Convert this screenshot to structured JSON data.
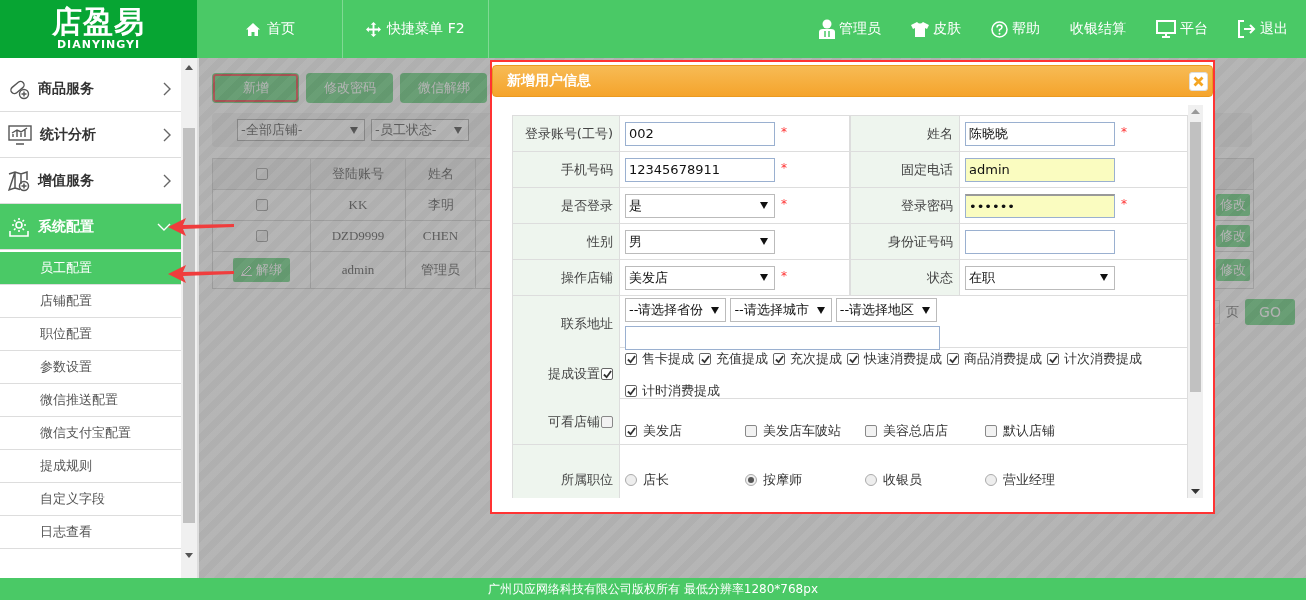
{
  "header": {
    "logo_title": "店盈易",
    "logo_subtitle": "DIANYINGYI",
    "nav": [
      "首页",
      "快捷菜单 F2"
    ],
    "actions": [
      "管理员",
      "皮肤",
      "帮助",
      "收银结算",
      "平台",
      "退出"
    ]
  },
  "sidebar": {
    "items": [
      {
        "label": "商品服务",
        "expanded": false,
        "annotated": false
      },
      {
        "label": "统计分析",
        "expanded": false,
        "annotated": false
      },
      {
        "label": "增值服务",
        "expanded": false,
        "annotated": false
      },
      {
        "label": "系统配置",
        "expanded": true,
        "annotated": true,
        "children": [
          {
            "label": "员工配置",
            "selected": true,
            "annotated": true
          },
          {
            "label": "店铺配置",
            "selected": false,
            "annotated": false
          },
          {
            "label": "职位配置",
            "selected": false,
            "annotated": false
          },
          {
            "label": "参数设置",
            "selected": false,
            "annotated": false
          },
          {
            "label": "微信推送配置",
            "selected": false,
            "annotated": false
          },
          {
            "label": "微信支付宝配置",
            "selected": false,
            "annotated": false
          },
          {
            "label": "提成规则",
            "selected": false,
            "annotated": false
          },
          {
            "label": "自定义字段",
            "selected": false,
            "annotated": false
          },
          {
            "label": "日志查看",
            "selected": false,
            "annotated": false
          }
        ]
      }
    ]
  },
  "toolbar": [
    {
      "label": "新增",
      "highlighted": true
    },
    {
      "label": "修改密码",
      "highlighted": false
    },
    {
      "label": "微信解绑",
      "highlighted": false
    }
  ],
  "filters": [
    "-全部店铺-",
    "-员工状态-"
  ],
  "table": {
    "select_all_checked": false,
    "columns": [
      "登陆账号",
      "姓名"
    ],
    "rows": [
      {
        "kind": "checkbox",
        "checked": false,
        "account": "KK",
        "name": "李明",
        "action": "修改"
      },
      {
        "kind": "checkbox",
        "checked": false,
        "account": "DZD9999",
        "name": "CHEN",
        "action": "修改"
      },
      {
        "kind": "unbind",
        "unbind": "解绑",
        "account": "admin",
        "name": "管理员",
        "action": "修改"
      }
    ]
  },
  "pager": {
    "page_label": "页",
    "go": "GO"
  },
  "dialog": {
    "title": "新增用户信息",
    "rows": [
      {
        "kind": "pair",
        "fields": [
          {
            "label": "登录账号(工号)",
            "kind": "text",
            "value": "002",
            "required_mark": "*",
            "autofill": false
          },
          {
            "label": "姓名",
            "kind": "text",
            "value": "陈晓晓",
            "required_mark": "*",
            "autofill": false
          }
        ]
      },
      {
        "kind": "pair",
        "fields": [
          {
            "label": "手机号码",
            "kind": "text",
            "value": "12345678911",
            "required_mark": "*",
            "autofill": false
          },
          {
            "label": "固定电话",
            "kind": "text",
            "value": "admin",
            "autofill": true
          }
        ]
      },
      {
        "kind": "pair",
        "fields": [
          {
            "label": "是否登录",
            "kind": "select",
            "value": "是",
            "required_mark": "*",
            "autofill": false
          },
          {
            "label": "登录密码",
            "kind": "password",
            "value": "••••••",
            "required_mark": "*",
            "autofill": true
          }
        ]
      },
      {
        "kind": "pair",
        "fields": [
          {
            "label": "性别",
            "kind": "select",
            "value": "男",
            "autofill": false
          },
          {
            "label": "身份证号码",
            "kind": "text",
            "autofill": false
          }
        ]
      },
      {
        "kind": "pair",
        "fields": [
          {
            "label": "操作店铺",
            "kind": "select",
            "value": "美发店",
            "required_mark": "*",
            "autofill": false
          },
          {
            "label": "状态",
            "kind": "select",
            "value": "在职",
            "autofill": false
          }
        ]
      },
      {
        "kind": "address",
        "label": "联系地址",
        "selects": [
          "--请选择省份",
          "--请选择城市",
          "--请选择地区"
        ]
      },
      {
        "kind": "checklist",
        "label": "提成设置",
        "checked": true,
        "options": [
          {
            "label": "售卡提成",
            "checked": true
          },
          {
            "label": "充值提成",
            "checked": true
          },
          {
            "label": "充次提成",
            "checked": true
          },
          {
            "label": "快速消费提成",
            "checked": true
          },
          {
            "label": "商品消费提成",
            "checked": true
          },
          {
            "label": "计次消费提成",
            "checked": true
          },
          {
            "label": "计时消费提成",
            "checked": true
          }
        ]
      },
      {
        "kind": "checkgrid",
        "label": "可看店铺",
        "checked": false,
        "options": [
          {
            "label": "美发店",
            "checked": true
          },
          {
            "label": "美发店车陂站",
            "checked": false
          },
          {
            "label": "美容总店店",
            "checked": false
          },
          {
            "label": "默认店铺",
            "checked": false
          }
        ]
      },
      {
        "kind": "radiogrid",
        "label": "所属职位",
        "options": [
          {
            "label": "店长",
            "selected": false
          },
          {
            "label": "按摩师",
            "selected": true
          },
          {
            "label": "收银员",
            "selected": false
          },
          {
            "label": "营业经理",
            "selected": false
          }
        ]
      }
    ]
  },
  "footer": "广州贝应网络科技有限公司版权所有 最低分辨率1280*768px"
}
